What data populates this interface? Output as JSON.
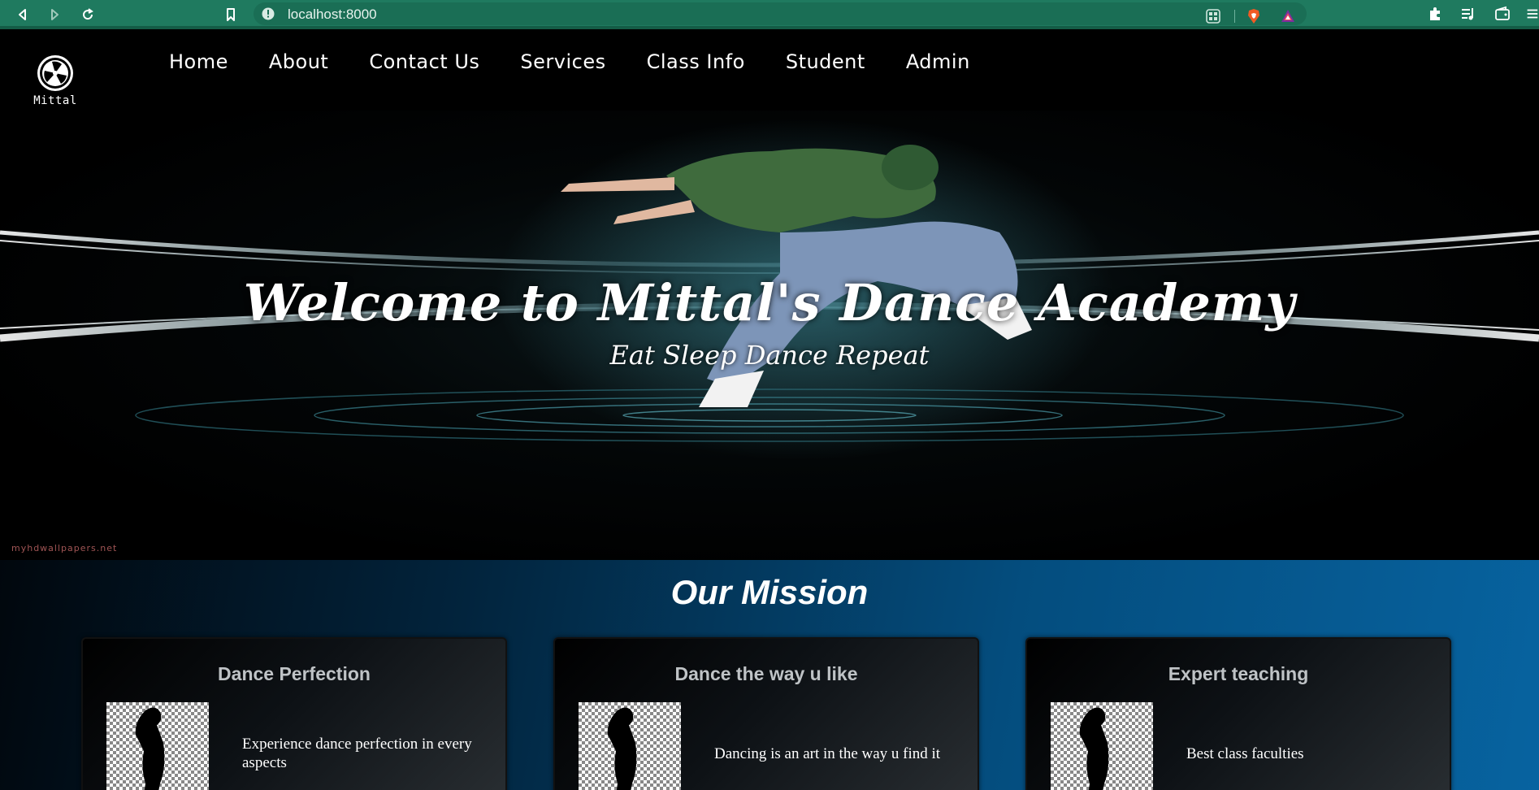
{
  "browser": {
    "url": "localhost:8000",
    "toolbar_icons": [
      "back-icon",
      "forward-icon",
      "reload-icon",
      "bookmark-icon",
      "site-info-icon",
      "qr-icon",
      "brave-shield-icon",
      "brave-rewards-icon",
      "extensions-icon",
      "playlist-icon",
      "wallet-icon",
      "menu-icon"
    ]
  },
  "site": {
    "logo_text": "Mittal",
    "nav": {
      "items": [
        {
          "label": "Home"
        },
        {
          "label": "About"
        },
        {
          "label": "Contact Us"
        },
        {
          "label": "Services"
        },
        {
          "label": "Class Info"
        },
        {
          "label": "Student"
        },
        {
          "label": "Admin"
        }
      ]
    }
  },
  "hero": {
    "title": "Welcome to Mittal's Dance Academy",
    "subtitle": "Eat Sleep Dance Repeat",
    "watermark": "myhdwallpapers.net"
  },
  "mission": {
    "title": "Our Mission",
    "cards": [
      {
        "title": "Dance Perfection",
        "text": "Experience dance perfection in every aspects"
      },
      {
        "title": "Dance the way u like",
        "text": "Dancing is an art in the way u find it"
      },
      {
        "title": "Expert teaching",
        "text": "Best class faculties"
      }
    ]
  },
  "colors": {
    "browser_bar": "#1f7a5f",
    "page_background": "#000000",
    "mission_gradient_end": "#0763a0",
    "card_title": "#bfc3c6"
  }
}
